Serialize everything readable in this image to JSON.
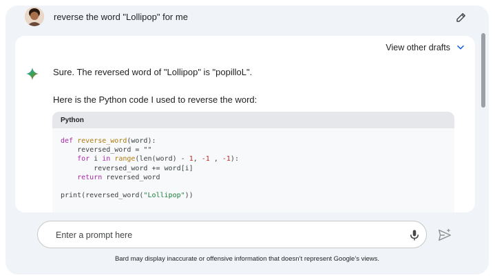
{
  "user": {
    "prompt": "reverse the word \"Lollipop\" for me"
  },
  "response": {
    "view_drafts_label": "View other drafts",
    "line1": "Sure. The reversed word of \"Lollipop\" is \"popilloL\".",
    "line2": "Here is the Python code I used to reverse the word:",
    "code_language": "Python",
    "code": {
      "l1_def": "def",
      "l1_fn": "reverse_word",
      "l1_rest": "(word):",
      "l2": "    reversed_word = \"\"",
      "l3_for": "for",
      "l3_i": " i ",
      "l3_in": "in",
      "l3_range": "range",
      "l3_len": "(len(word) - ",
      "l3_n1": "1",
      "l3_c1": ", ",
      "l3_n2": "-1",
      "l3_c2": " , ",
      "l3_n3": "-1",
      "l3_end": "):",
      "l4": "        reversed_word += word[i]",
      "l5_return": "return",
      "l5_rest": " reversed_word",
      "l7_print": "print(reversed_word(",
      "l7_str": "\"Lollipop\"",
      "l7_end": "))"
    }
  },
  "input": {
    "placeholder": "Enter a prompt here"
  },
  "footer": {
    "disclaimer": "Bard may display inaccurate or offensive information that doesn’t represent Google’s views."
  },
  "colors": {
    "background": "#f0f4f9",
    "card": "#ffffff",
    "keyword": "#a626a4",
    "function": "#b0790e",
    "number": "#c5221f",
    "string": "#188038"
  },
  "icons": [
    "avatar",
    "pencil-icon",
    "chevron-down-icon",
    "bard-sparkle-icon",
    "mic-icon",
    "send-icon"
  ]
}
